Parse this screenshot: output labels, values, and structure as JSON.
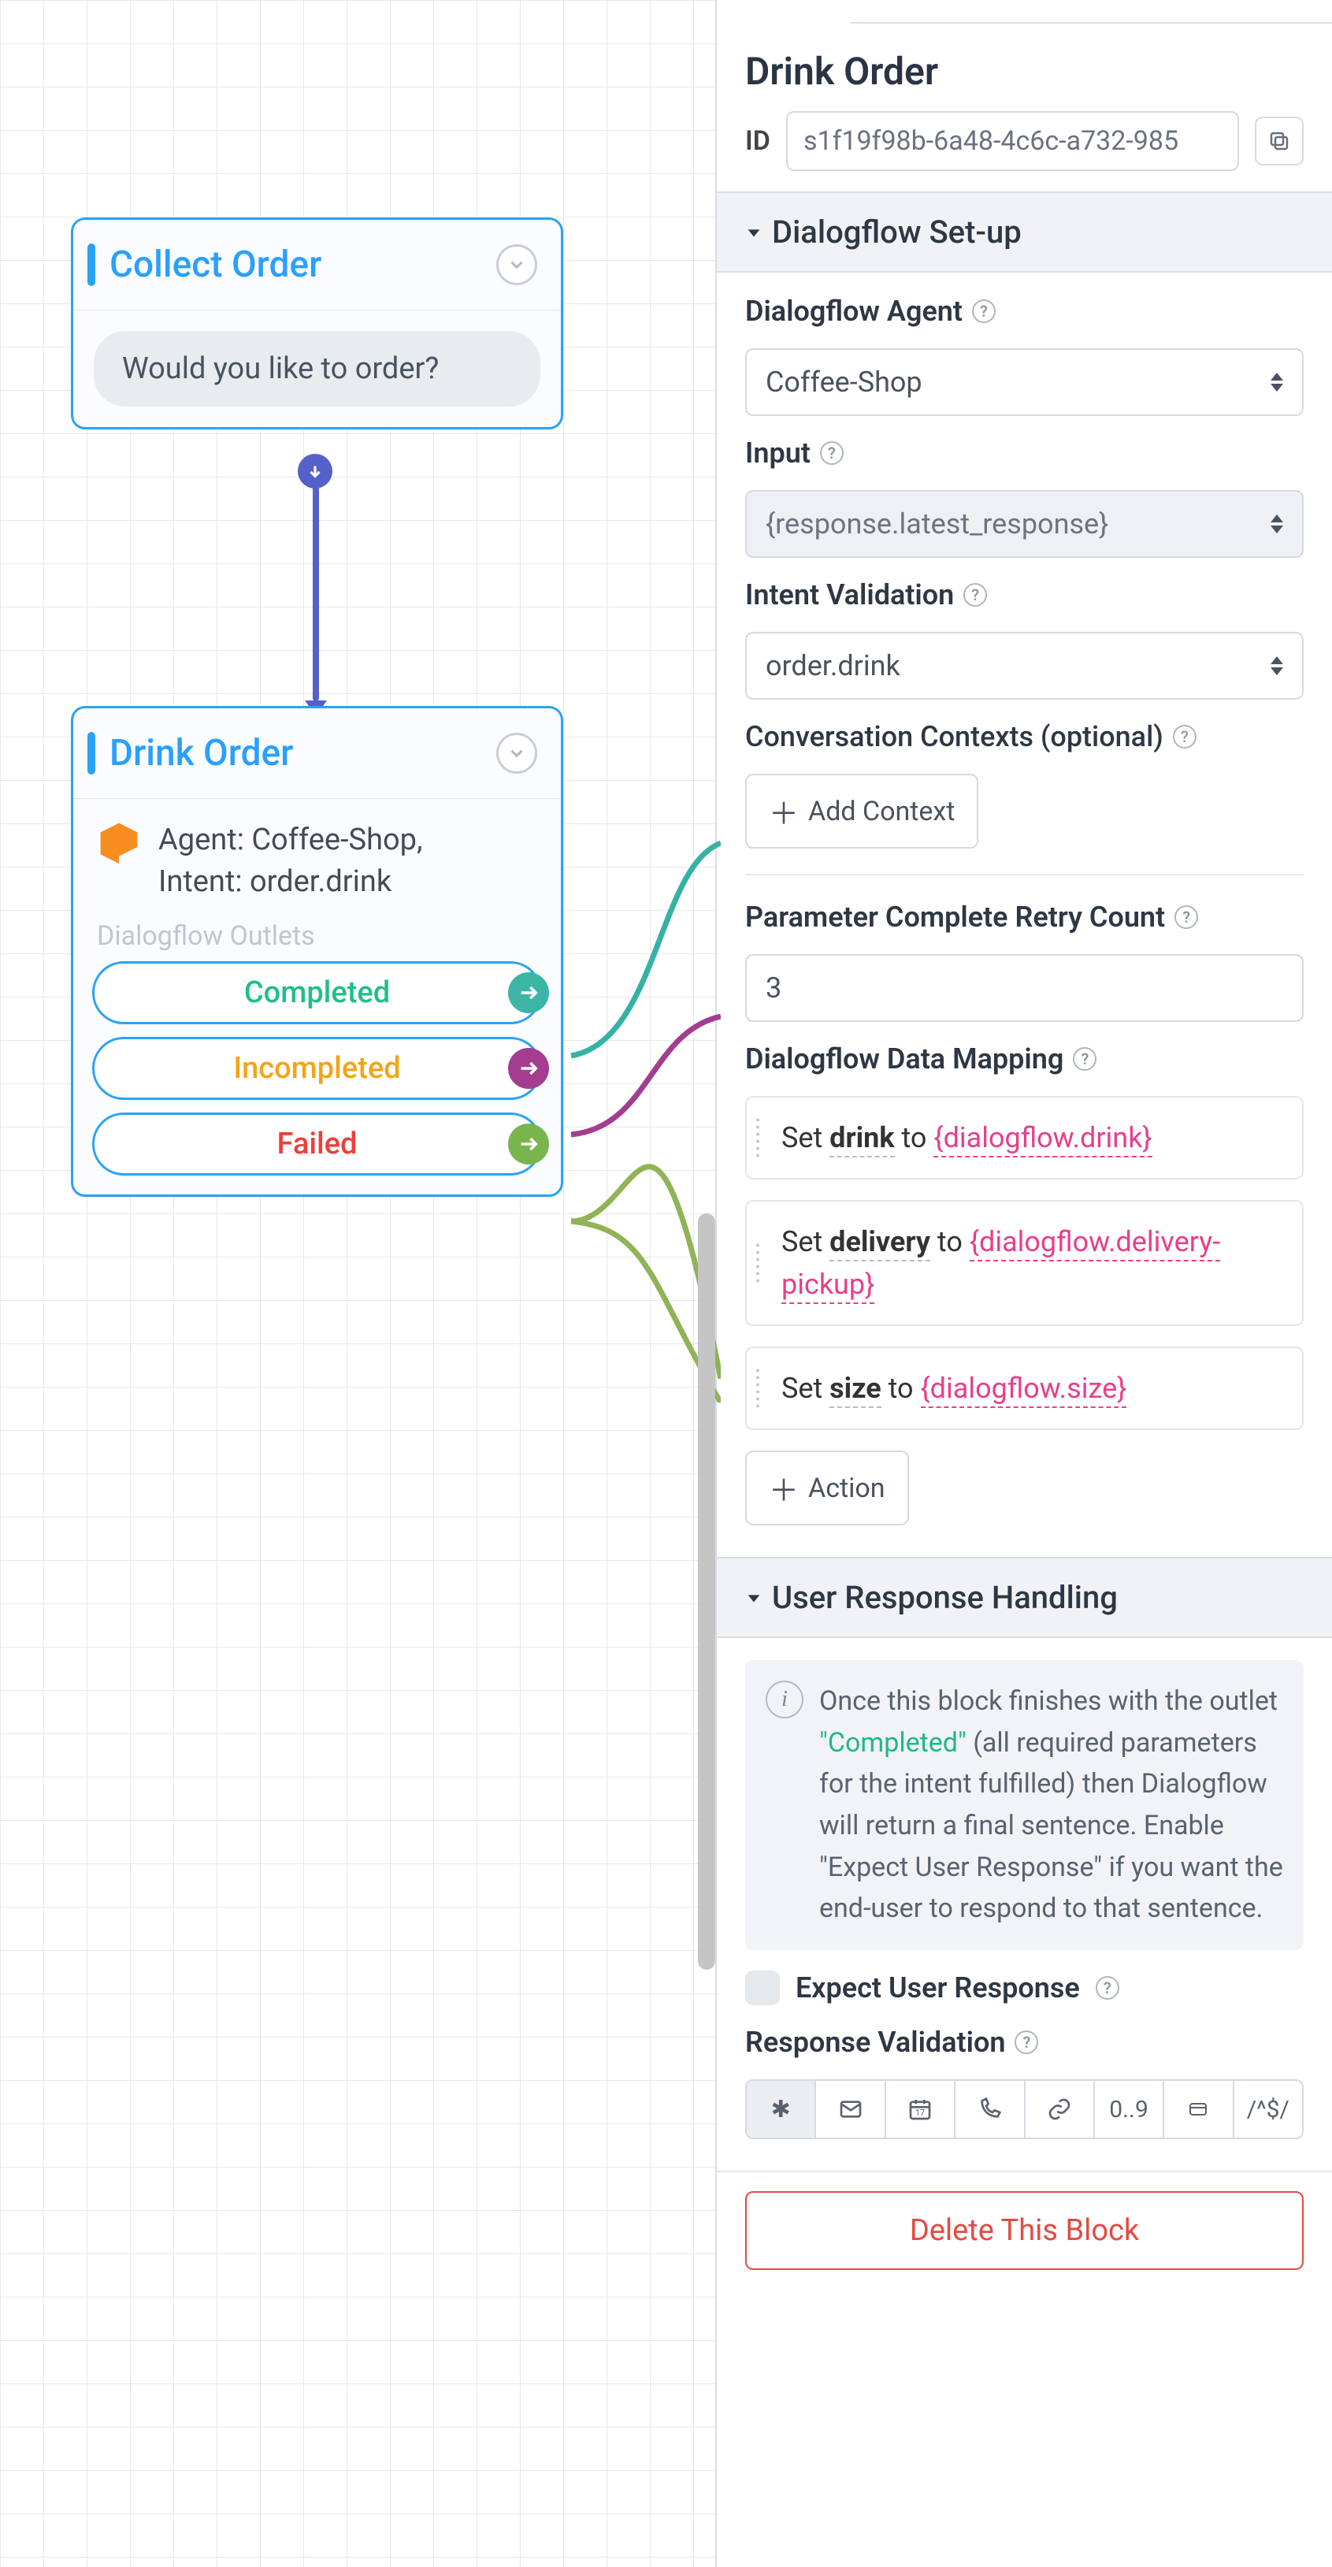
{
  "canvas": {
    "node_collect": {
      "title": "Collect Order",
      "prompt": "Would you like to order?"
    },
    "node_drink": {
      "title": "Drink Order",
      "agent_line": "Agent: Coffee-Shop,",
      "intent_line": "Intent: order.drink",
      "outlets_label": "Dialogflow Outlets",
      "outlets": {
        "completed": "Completed",
        "incompleted": "Incompleted",
        "failed": "Failed"
      }
    }
  },
  "panel": {
    "title": "Drink Order",
    "id_label": "ID",
    "id_value": "s1f19f98b-6a48-4c6c-a732-985",
    "sections": {
      "setup": "Dialogflow Set-up",
      "response": "User Response Handling"
    },
    "fields": {
      "agent_label": "Dialogflow Agent",
      "agent_value": "Coffee-Shop",
      "input_label": "Input",
      "input_value": "{response.latest_response}",
      "intent_label": "Intent Validation",
      "intent_value": "order.drink",
      "contexts_label": "Conversation Contexts (optional)",
      "add_context": "Add Context",
      "retry_label": "Parameter Complete Retry Count",
      "retry_value": "3",
      "mapping_label": "Dialogflow Data Mapping",
      "add_action": "Action"
    },
    "mappings": [
      {
        "set": "Set ",
        "var": "drink",
        "to": " to  ",
        "val": "{dialogflow.drink}"
      },
      {
        "set": "Set ",
        "var": "delivery",
        "to": " to  ",
        "val": "{dialogflow.delivery-pickup}"
      },
      {
        "set": "Set ",
        "var": "size",
        "to": " to  ",
        "val": "{dialogflow.size}"
      }
    ],
    "info": {
      "pre": "Once this block finishes with the outlet ",
      "completed": "\"Completed\"",
      "post": " (all required parameters for the intent fulfilled) then Dialogflow will return a final sentence. Enable \"Expect User Response\" if you want the end-user to respond to that sentence."
    },
    "expect_label": "Expect User Response",
    "validation_label": "Response Validation",
    "validation_opts": {
      "asterisk": "✱",
      "range": "0..9",
      "regex": "/^$/"
    },
    "delete": "Delete This Block"
  }
}
